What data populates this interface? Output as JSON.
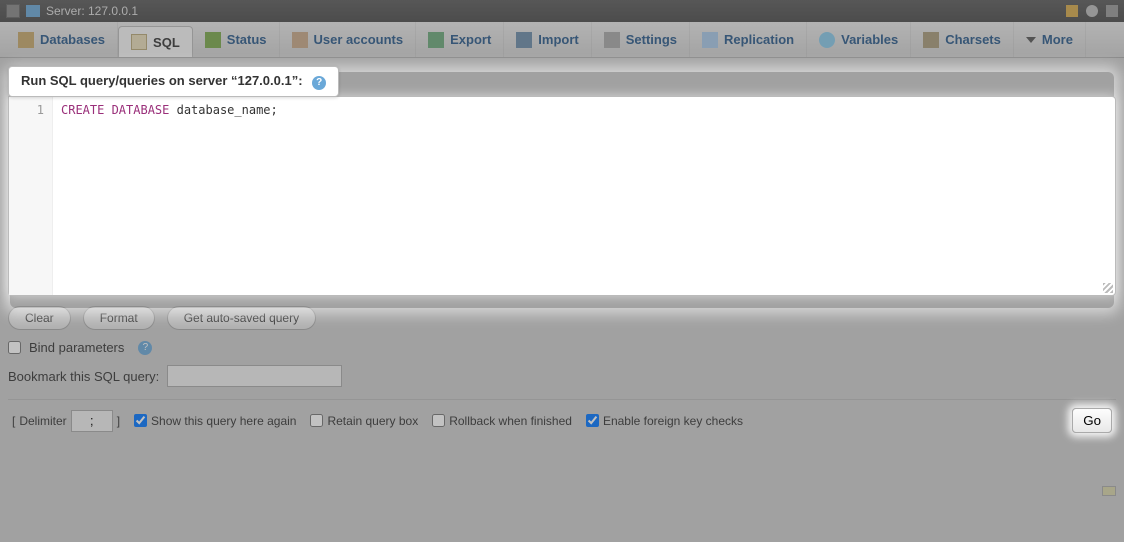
{
  "titlebar": {
    "label": "Server: 127.0.0.1"
  },
  "tabs": {
    "databases": "Databases",
    "sql": "SQL",
    "status": "Status",
    "user_accounts": "User accounts",
    "export": "Export",
    "import": "Import",
    "settings": "Settings",
    "replication": "Replication",
    "variables": "Variables",
    "charsets": "Charsets",
    "more": "More"
  },
  "panel": {
    "title": "Run SQL query/queries on server “127.0.0.1”:"
  },
  "editor": {
    "line_number": "1",
    "keyword": "CREATE DATABASE",
    "rest": " database_name;"
  },
  "buttons": {
    "clear": "Clear",
    "format": "Format",
    "autosaved": "Get auto-saved query",
    "go": "Go"
  },
  "options": {
    "bind_parameters": "Bind parameters",
    "bookmark_label": "Bookmark this SQL query:",
    "delimiter_label": "Delimiter",
    "delimiter_value": ";",
    "show_again": "Show this query here again",
    "retain_box": "Retain query box",
    "rollback": "Rollback when finished",
    "foreign_key": "Enable foreign key checks"
  },
  "checkbox_state": {
    "bind_parameters": false,
    "show_again": true,
    "retain_box": false,
    "rollback": false,
    "foreign_key": true
  }
}
